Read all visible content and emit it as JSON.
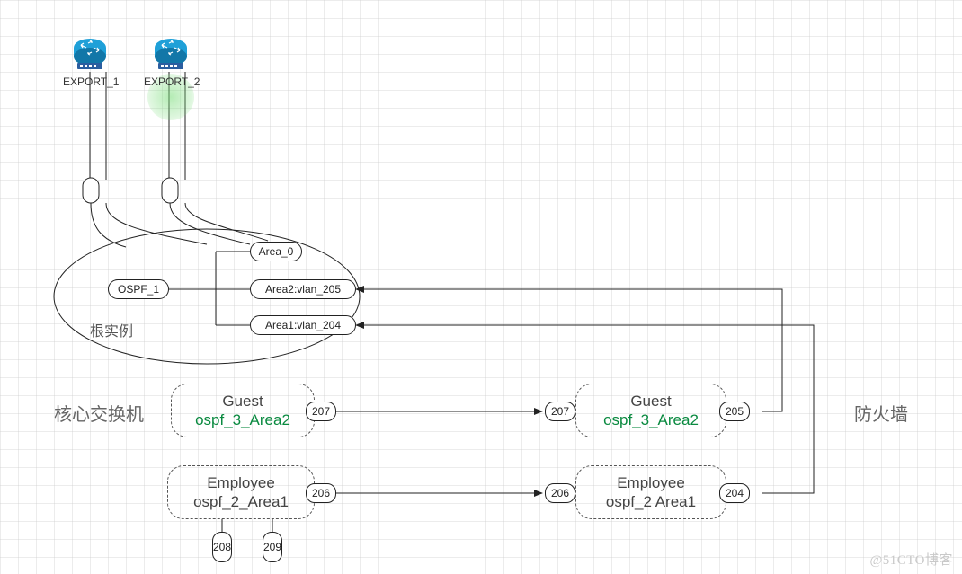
{
  "routers": {
    "export1": "EXPORT_1",
    "export2": "EXPORT_2"
  },
  "root_instance": {
    "container_label": "根实例",
    "ospf_label": "OSPF_1",
    "areas": {
      "area0": "Area_0",
      "area2": "Area2:vlan_205",
      "area1": "Area1:vlan_204"
    }
  },
  "core_switch_label": "核心交换机",
  "firewall_label": "防火墙",
  "guest_left": {
    "title": "Guest",
    "sub": "ospf_3_Area2",
    "port_right": "207"
  },
  "guest_right": {
    "title": "Guest",
    "sub": "ospf_3_Area2",
    "port_left": "207",
    "port_right": "205"
  },
  "emp_left": {
    "title": "Employee",
    "sub": "ospf_2_Area1",
    "port_right": "206",
    "port_b1": "208",
    "port_b2": "209"
  },
  "emp_right": {
    "title": "Employee",
    "sub": "ospf_2 Area1",
    "port_left": "206",
    "port_right": "204"
  },
  "watermark": "@51CTO博客"
}
